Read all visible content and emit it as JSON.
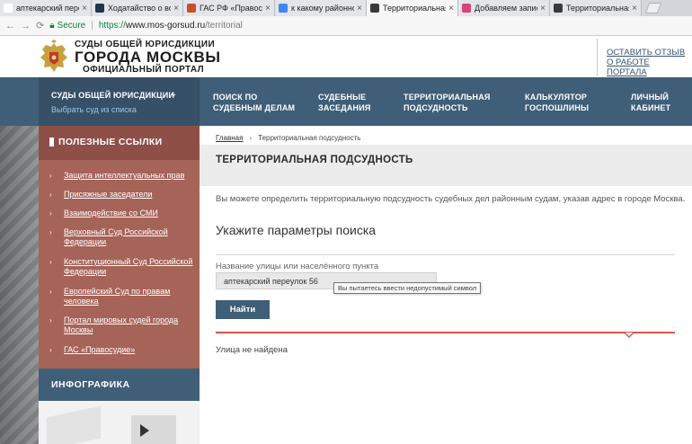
{
  "browser": {
    "tabs": [
      {
        "title": "аптекарский переул",
        "favicon_color": "#ffffff",
        "active": false
      },
      {
        "title": "Ходатайство о восст",
        "favicon_color": "#1f3550",
        "active": false
      },
      {
        "title": "ГАС РФ «Правосуди»",
        "favicon_color": "#c5512b",
        "active": false
      },
      {
        "title": "к какому районному",
        "favicon_color": "#4285f4",
        "active": false
      },
      {
        "title": "Территориальная по",
        "favicon_color": "#3a3a3a",
        "active": true
      },
      {
        "title": "Добавляем запись в",
        "favicon_color": "#d6457c",
        "active": false
      },
      {
        "title": "Территориальная по",
        "favicon_color": "#3a3a3a",
        "active": false
      }
    ],
    "secure_label": "Secure",
    "url_scheme": "https://",
    "url_host": "www.mos-gorsud.ru",
    "url_path": "/territorial"
  },
  "header": {
    "brand_line1": "СУДЫ ОБЩЕЙ ЮРИСДИКЦИИ",
    "brand_line2": "ГОРОДА МОСКВЫ",
    "brand_line3": "ОФИЦИАЛЬНЫЙ ПОРТАЛ",
    "feedback_line1": "ОСТАВИТЬ ОТЗЫВ",
    "feedback_line2": "О РАБОТЕ ПОРТАЛА"
  },
  "nav": {
    "courts_title": "СУДЫ ОБЩЕЙ ЮРИСДИКЦИИ",
    "courts_sub": "Выбрать суд из списка",
    "items": [
      {
        "l1": "ПОИСК ПО",
        "l2": "СУДЕБНЫМ ДЕЛАМ"
      },
      {
        "l1": "СУДЕБНЫЕ",
        "l2": "ЗАСЕДАНИЯ"
      },
      {
        "l1": "ТЕРРИТОРИАЛЬНАЯ",
        "l2": "ПОДСУДНОСТЬ"
      },
      {
        "l1": "КАЛЬКУЛЯТОР",
        "l2": "ГОСПОШЛИНЫ"
      },
      {
        "l1": "ЛИЧНЫЙ",
        "l2": "КАБИНЕТ"
      }
    ]
  },
  "sidebar": {
    "heading": "ПОЛЕЗНЫЕ ССЫЛКИ",
    "links": [
      "Защита интеллектуальных прав",
      "Присяжные заседатели",
      "Взаимодействие со СМИ",
      "Верховный Суд Российской Федерации",
      "Конституционный Суд Российской Федерации",
      "Европейский Суд по правам человека",
      "Портал мировых судей города Москвы",
      "ГАС «Правосудие»"
    ],
    "infographic_heading": "ИНФОГРАФИКА"
  },
  "main": {
    "breadcrumb_home": "Главная",
    "breadcrumb_current": "Территориальная подсудность",
    "title": "ТЕРРИТОРИАЛЬНАЯ ПОДСУДНОСТЬ",
    "intro": "Вы можете определить территориальную подсудность судебных дел районным судам, указав адрес в городе Москва.",
    "search_heading": "Укажите параметры поиска",
    "field_label": "Название улицы или населённого пункта",
    "field_value": "аптекарский переулок 56",
    "tooltip": "Вы пытаетесь ввести недопустимый символ",
    "button_label": "Найти",
    "result_text": "Улица не найдена"
  },
  "colors": {
    "nav_bg": "#3f5e77",
    "sidebar_bg": "#a66358",
    "accent_red": "#d9534f"
  }
}
